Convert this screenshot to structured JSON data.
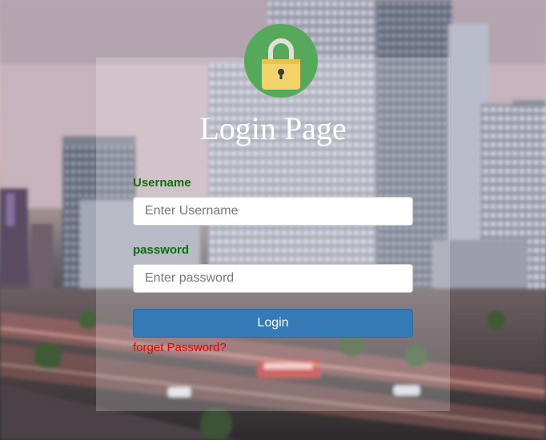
{
  "page": {
    "title": "Login Page"
  },
  "lock_icon": "padlock-icon",
  "form": {
    "username_label": "Username",
    "username_placeholder": "Enter Username",
    "username_value": "",
    "password_label": "password",
    "password_placeholder": "Enter password",
    "password_value": "",
    "login_label": "Login",
    "forget_label": "forget Password?"
  },
  "colors": {
    "badge": "#56a85a",
    "lock_body": "#f2d46a",
    "label_text": "#0e6e0e",
    "button": "#337ab7",
    "link": "#e60000",
    "title": "#ffffff"
  }
}
